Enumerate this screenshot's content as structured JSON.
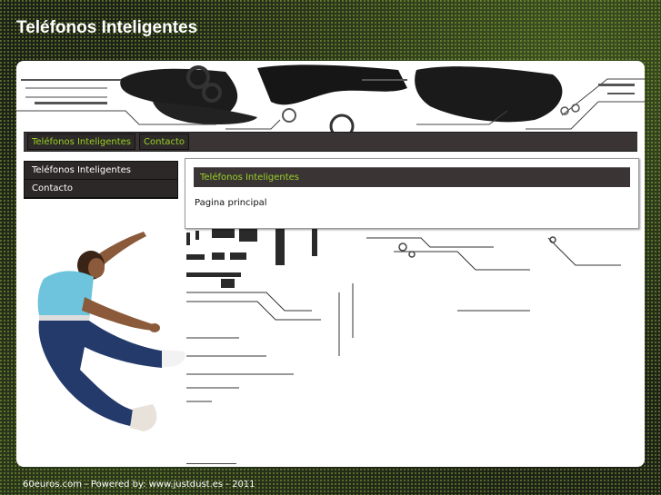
{
  "site": {
    "title": "Teléfonos Inteligentes"
  },
  "topnav": {
    "items": [
      {
        "label": "Teléfonos Inteligentes"
      },
      {
        "label": "Contacto"
      }
    ]
  },
  "sidebar": {
    "items": [
      {
        "label": "Teléfonos Inteligentes"
      },
      {
        "label": "Contacto"
      }
    ]
  },
  "main": {
    "heading": "Teléfonos Inteligentes",
    "body": "Pagina principal"
  },
  "footer": {
    "text": "60euros.com - Powered by: www.justdust.es - 2011"
  },
  "colors": {
    "accent": "#9ad027",
    "nav_bg": "#3a3534",
    "page_bg": "#1d2117"
  },
  "icons": [
    "dancer-illustration",
    "circuit-banner-graphic"
  ]
}
